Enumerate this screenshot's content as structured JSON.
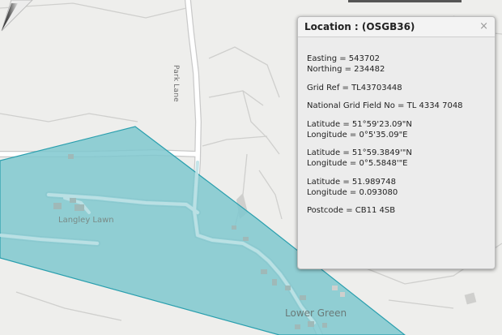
{
  "map": {
    "labels": {
      "park_lane": "Park Lane",
      "langley_lawn": "Langley Lawn",
      "lower_green": "Lower Green"
    },
    "colors": {
      "background": "#eeeeec",
      "road": "#ffffff",
      "road_casing": "#cfcfcf",
      "polygon_fill": "#7fc8cf",
      "polygon_stroke": "#2a9fae"
    }
  },
  "popup": {
    "title": "Location : (OSGB36)",
    "close_icon": "close-icon",
    "easting": "Easting = 543702",
    "northing": "Northing = 234482",
    "grid_ref": "Grid Ref = TL43703448",
    "national_grid": "National Grid Field No = TL 4334 7048",
    "lat_dms": "Latitude = 51°59'23.09\"N",
    "lon_dms": "Longitude = 0°5'35.09\"E",
    "lat_dm": "Latitude = 51°59.3849'\"N",
    "lon_dm": "Longitude = 0°5.5848'\"E",
    "lat_dec": "Latitude = 51.989748",
    "lon_dec": "Longitude = 0.093080",
    "postcode": "Postcode = CB11 4SB"
  }
}
